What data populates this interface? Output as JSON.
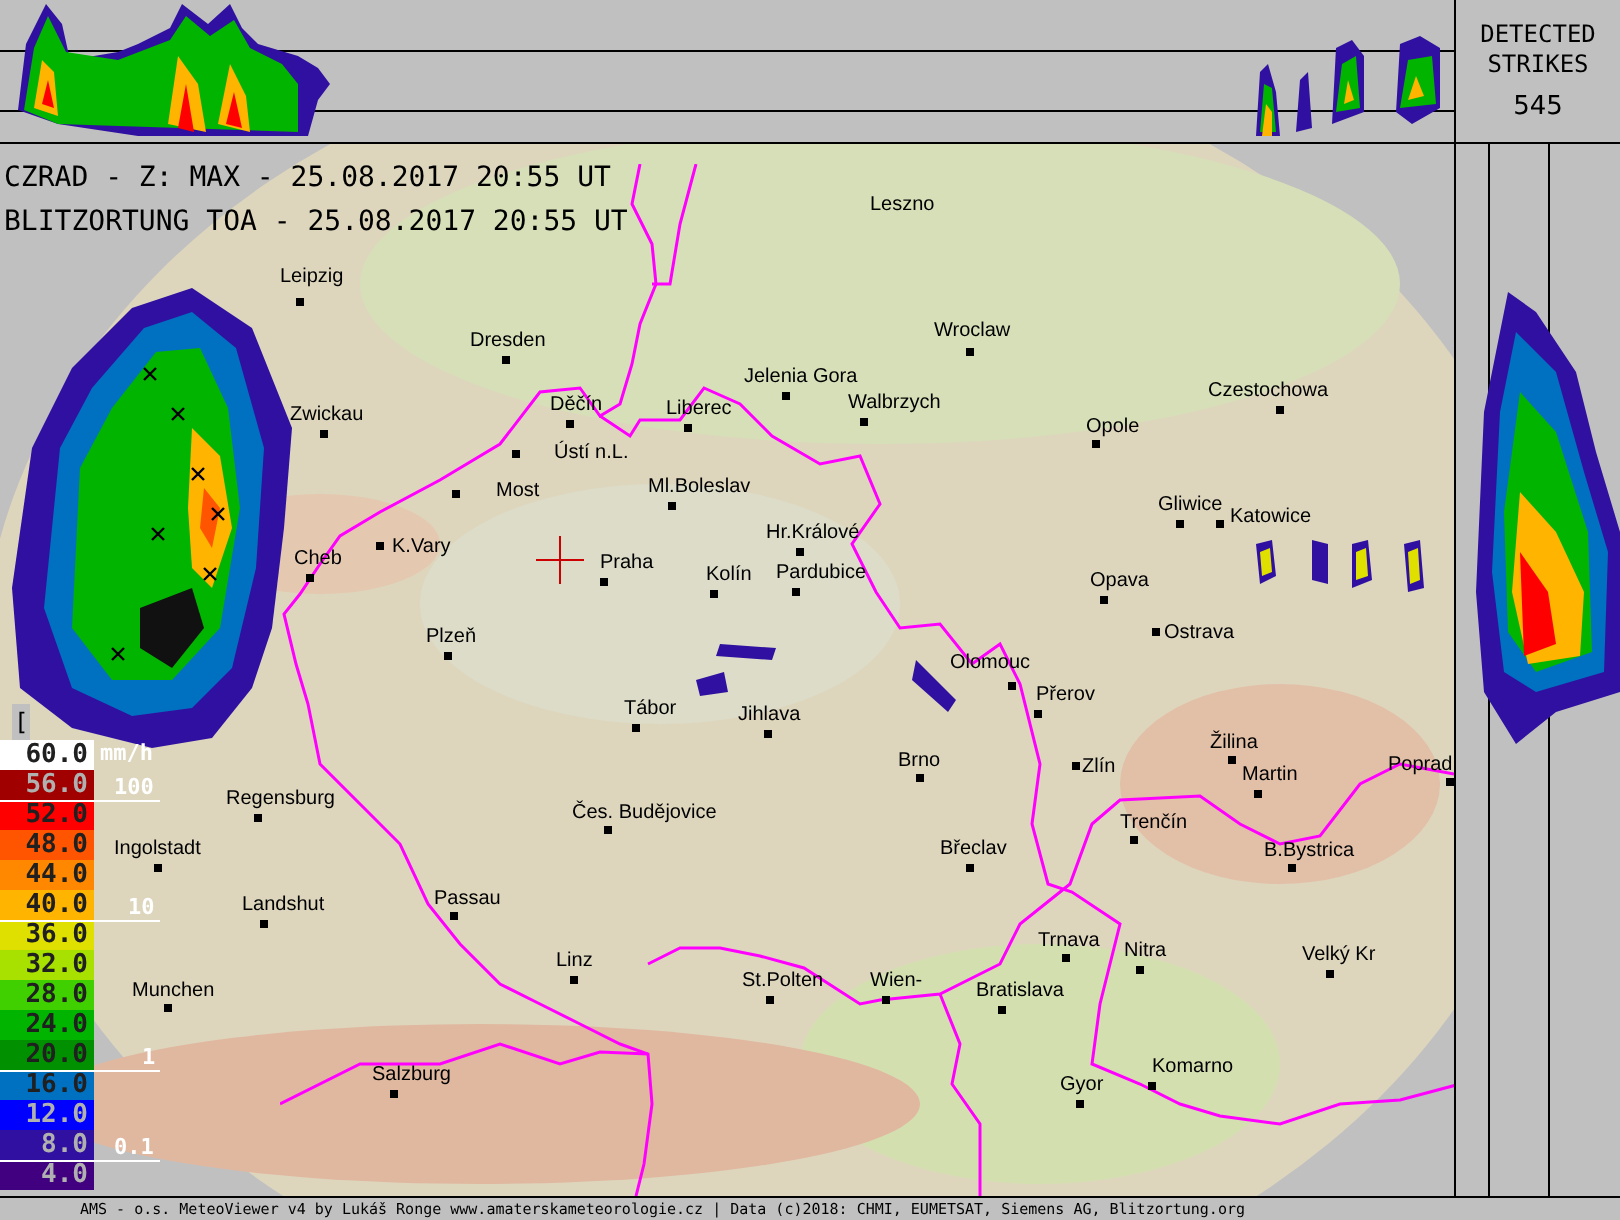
{
  "header": {
    "radar_line": "CZRAD - Z: MAX - 25.08.2017 20:55 UT",
    "lightning_line": "BLITZORTUNG TOA - 25.08.2017 20:55 UT"
  },
  "strikes": {
    "label_lines": [
      "DETECTED",
      "STRIKES"
    ],
    "count": "545"
  },
  "legend": {
    "unit_bracket": "[",
    "rate_unit": "mm/h",
    "scale": [
      {
        "value": "60.0",
        "color": "#ffffff"
      },
      {
        "value": "56.0",
        "color": "#a00000"
      },
      {
        "value": "52.0",
        "color": "#ff0000"
      },
      {
        "value": "48.0",
        "color": "#ff5500"
      },
      {
        "value": "44.0",
        "color": "#ff8800"
      },
      {
        "value": "40.0",
        "color": "#ffb400"
      },
      {
        "value": "36.0",
        "color": "#e0e000"
      },
      {
        "value": "32.0",
        "color": "#a8e000"
      },
      {
        "value": "28.0",
        "color": "#40d000"
      },
      {
        "value": "24.0",
        "color": "#00b400"
      },
      {
        "value": "20.0",
        "color": "#009000"
      },
      {
        "value": "16.0",
        "color": "#0070c0"
      },
      {
        "value": "12.0",
        "color": "#0000ff"
      },
      {
        "value": "8.0",
        "color": "#3010a0"
      },
      {
        "value": "4.0",
        "color": "#400080"
      }
    ],
    "rate_marks": [
      {
        "label": "100"
      },
      {
        "label": "10"
      },
      {
        "label": "1"
      },
      {
        "label": "0.1"
      }
    ]
  },
  "cities": [
    {
      "name": "Leszno"
    },
    {
      "name": "Leipzig"
    },
    {
      "name": "Dresden"
    },
    {
      "name": "Wroclaw"
    },
    {
      "name": "Jelenia Gora"
    },
    {
      "name": "Walbrzych"
    },
    {
      "name": "Opole"
    },
    {
      "name": "Czestochowa"
    },
    {
      "name": "Zwickau"
    },
    {
      "name": "Děčín"
    },
    {
      "name": "Liberec"
    },
    {
      "name": "Ústí n.L."
    },
    {
      "name": "Most"
    },
    {
      "name": "Ml.Boleslav"
    },
    {
      "name": "Gliwice"
    },
    {
      "name": "Katowice"
    },
    {
      "name": "K.Vary"
    },
    {
      "name": "Hr.Králové"
    },
    {
      "name": "Cheb"
    },
    {
      "name": "Praha"
    },
    {
      "name": "Kolín"
    },
    {
      "name": "Pardubice"
    },
    {
      "name": "Opava"
    },
    {
      "name": "Ostrava"
    },
    {
      "name": "Plzeň"
    },
    {
      "name": "Olomouc"
    },
    {
      "name": "Tábor"
    },
    {
      "name": "Jihlava"
    },
    {
      "name": "Přerov"
    },
    {
      "name": "Žilina"
    },
    {
      "name": "Martin"
    },
    {
      "name": "Brno"
    },
    {
      "name": "Zlín"
    },
    {
      "name": "Poprad"
    },
    {
      "name": "Regensburg"
    },
    {
      "name": "Trenčín"
    },
    {
      "name": "Čes. Budějovice"
    },
    {
      "name": "Ingolstadt"
    },
    {
      "name": "Břeclav"
    },
    {
      "name": "B.Bystrica"
    },
    {
      "name": "Landshut"
    },
    {
      "name": "Passau"
    },
    {
      "name": "Trnava"
    },
    {
      "name": "Nitra"
    },
    {
      "name": "Linz"
    },
    {
      "name": "Munchen"
    },
    {
      "name": "St.Polten"
    },
    {
      "name": "Wien-"
    },
    {
      "name": "Bratislava"
    },
    {
      "name": "Velký Kr"
    },
    {
      "name": "Komarno"
    },
    {
      "name": "Salzburg"
    },
    {
      "name": "Gyor"
    }
  ],
  "footer": "AMS - o.s. MeteoViewer v4 by Lukáš Ronge www.amaterskameteorologie.cz | Data (c)2018: CHMI, EUMETSAT, Siemens AG, Blitzortung.org"
}
